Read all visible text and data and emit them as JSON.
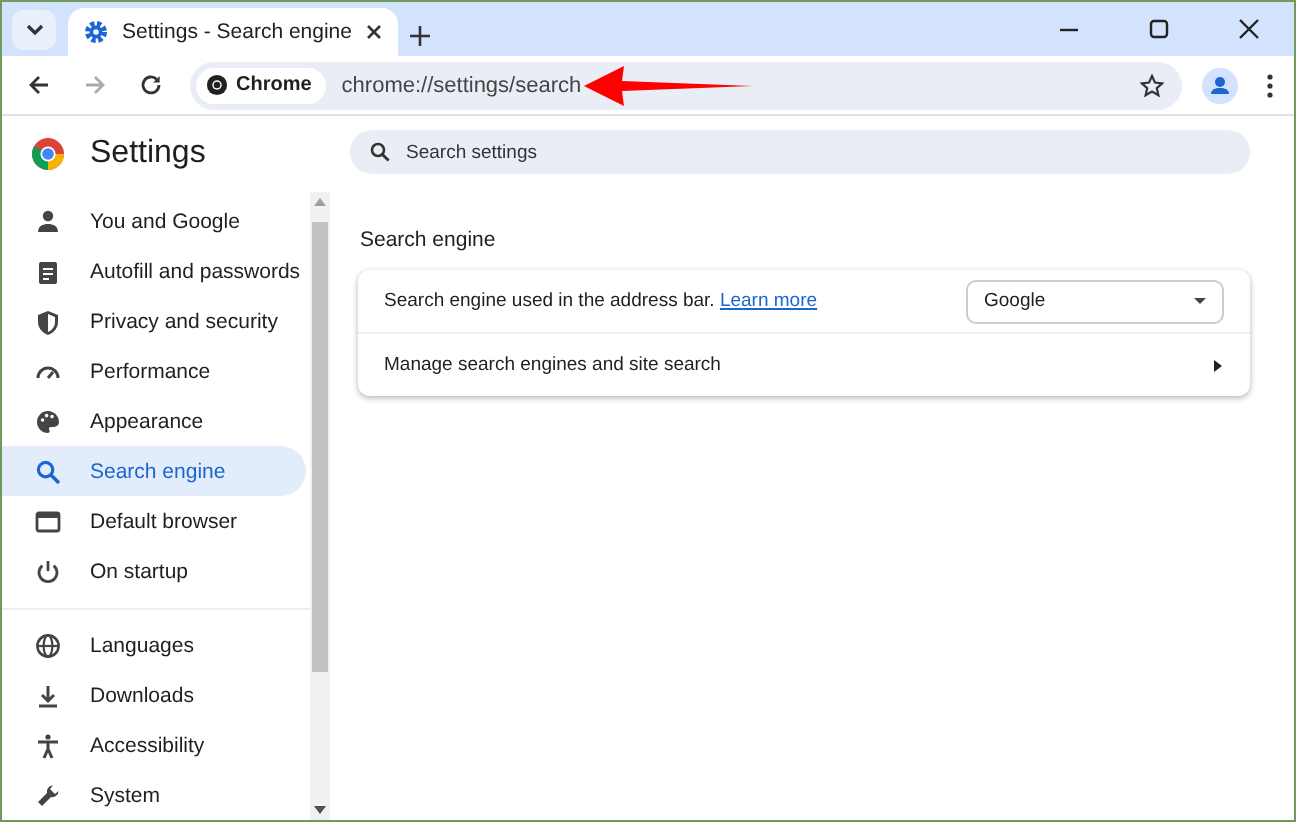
{
  "tabs": [
    {
      "title": "Settings - Search engine",
      "selected": true
    }
  ],
  "address_bar": {
    "chip": "Chrome",
    "url": "chrome://settings/search"
  },
  "sidebar": {
    "title": "Settings",
    "groups": [
      {
        "items": [
          {
            "label": "You and Google",
            "selected": false
          },
          {
            "label": "Autofill and passwords",
            "selected": false
          },
          {
            "label": "Privacy and security",
            "selected": false
          },
          {
            "label": "Performance",
            "selected": false
          },
          {
            "label": "Appearance",
            "selected": false
          },
          {
            "label": "Search engine",
            "selected": true
          },
          {
            "label": "Default browser",
            "selected": false
          },
          {
            "label": "On startup",
            "selected": false
          }
        ]
      },
      {
        "items": [
          {
            "label": "Languages",
            "selected": false
          },
          {
            "label": "Downloads",
            "selected": false
          },
          {
            "label": "Accessibility",
            "selected": false
          },
          {
            "label": "System",
            "selected": false
          }
        ]
      }
    ]
  },
  "search": {
    "placeholder": "Search settings"
  },
  "main": {
    "section_title": "Search engine",
    "rows": [
      {
        "kind": "select",
        "label": "Search engine used in the address bar.",
        "link": "Learn more",
        "value": "Google"
      },
      {
        "kind": "submenu",
        "label": "Manage search engines and site search"
      }
    ]
  }
}
